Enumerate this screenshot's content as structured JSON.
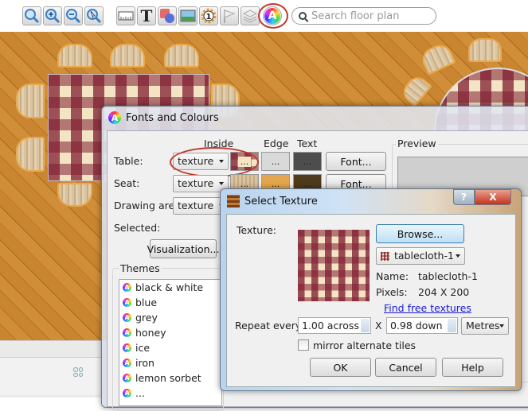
{
  "toolbar": {
    "buttons": [
      {
        "name": "zoom-fit",
        "icon": "magnifier-icon"
      },
      {
        "name": "zoom-in",
        "icon": "zoom-in-icon"
      },
      {
        "name": "zoom-out",
        "icon": "zoom-out-icon"
      },
      {
        "name": "zoom-select",
        "icon": "zoom-pointer-icon"
      },
      {
        "name": "ruler",
        "icon": "ruler-icon"
      },
      {
        "name": "text",
        "icon": "text-icon"
      },
      {
        "name": "shapes",
        "icon": "shapes-icon"
      },
      {
        "name": "image",
        "icon": "image-icon"
      },
      {
        "name": "table-number",
        "icon": "table-number-icon"
      },
      {
        "name": "flag",
        "icon": "flag-icon"
      },
      {
        "name": "layers",
        "icon": "layers-icon"
      },
      {
        "name": "fonts-and-colours",
        "icon": "fonts-colours-icon"
      }
    ],
    "table_number_label": "1",
    "text_tool_label": "T",
    "search_placeholder": "Search floor plan"
  },
  "fonts_dialog": {
    "title": "Fonts and Colours",
    "columns": {
      "inside": "Inside",
      "edge": "Edge",
      "text": "Text",
      "preview": "Preview"
    },
    "rows": [
      {
        "label": "Table:",
        "inside": "texture",
        "swatch_label": "...",
        "edge_label": "...",
        "text_label": "...",
        "font_button": "Font...",
        "edge_color": "#d9d9d9",
        "text_color": "#4d4d4d"
      },
      {
        "label": "Seat:",
        "inside": "texture",
        "swatch_label": "...",
        "edge_label": "...",
        "text_label": "...",
        "font_button": "Font...",
        "edge_color": "#e4a64c",
        "text_color": "#4f3a1c"
      },
      {
        "label": "Drawing area:",
        "inside": "texture"
      }
    ],
    "selected_label": "Selected:",
    "visualization_button": "Visualization...",
    "themes_label": "Themes",
    "themes": [
      "black & white",
      "blue",
      "grey",
      "honey",
      "ice",
      "iron",
      "lemon sorbet",
      "..."
    ]
  },
  "texture_dialog": {
    "title": "Select Texture",
    "help_button": "?",
    "close_button": "X",
    "texture_label": "Texture:",
    "browse_button": "Browse...",
    "texture_select": "tablecloth-1",
    "name_label": "Name:",
    "name_value": "tablecloth-1",
    "pixels_label": "Pixels:",
    "pixels_value": "204 X 200",
    "find_link": "Find free textures",
    "repeat_label": "Repeat every:",
    "across_value": "1.00 across",
    "x_label": "X",
    "down_value": "0.98 down",
    "units": "Metres",
    "mirror_label": "mirror alternate tiles",
    "mirror_checked": false,
    "ok_button": "OK",
    "cancel_button": "Cancel",
    "help_text_button": "Help"
  },
  "colors": {
    "highlight": "#c0392b",
    "link": "#1a1adc",
    "gingham_red": "#801e32",
    "gingham_cream": "#f3e5c4"
  }
}
